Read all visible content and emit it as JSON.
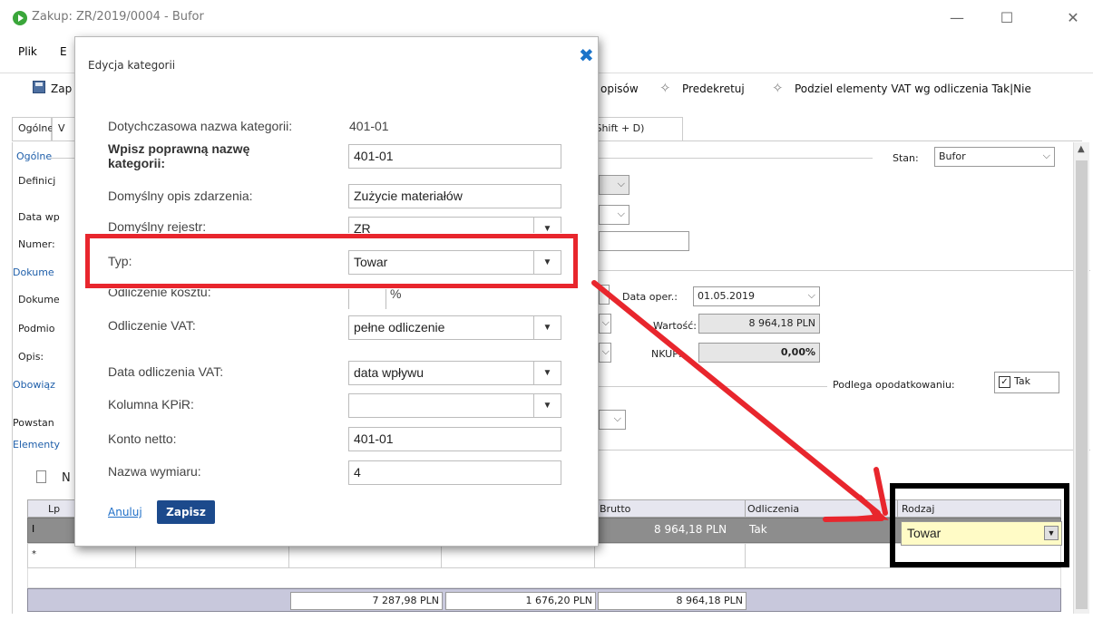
{
  "window": {
    "title": "Zakup: ZR/2019/0004 - Bufor",
    "minimize": "—",
    "maximize": "☐",
    "close": "✕"
  },
  "menu": {
    "file": "Plik",
    "edit": "E"
  },
  "toolbar": {
    "save_partial": "Zap",
    "opisow": "opisów",
    "predekretuj": "Predekretuj",
    "podziel": "Podziel elementy VAT wg odliczenia Tak|Nie"
  },
  "tabs": {
    "general": "Ogólne",
    "second": "V",
    "shortcut_tab": "- Shift + D)"
  },
  "form": {
    "ogolne_group": "Ogólne",
    "definicja": "Definicj",
    "data_wp": "Data wp",
    "numer": "Numer:",
    "dokume_group": "Dokume",
    "dokume": "Dokume",
    "podmiot": "Podmio",
    "opis": "Opis:",
    "obowiaz": "Obowiąz",
    "powstan": "Powstan",
    "elementy": "Elementy",
    "stan_label": "Stan:",
    "stan_value": "Bufor",
    "data_oper_label": "Data oper.:",
    "data_oper_value": "01.05.2019",
    "wartosc_label": "Wartość:",
    "wartosc_value": "8 964,18 PLN",
    "nkup_label": "NKUP:",
    "nkup_value": "0,00%",
    "podlega_label": "Podlega opodatkowaniu:",
    "podlega_value": "Tak",
    "new_partial": "N"
  },
  "grid": {
    "headers": {
      "lp": "Lp",
      "brutto": "Brutto",
      "odliczenia": "Odliczenia",
      "rodzaj": "Rodzaj"
    },
    "row1": {
      "marker": "I",
      "brutto": "8 964,18 PLN",
      "odliczenia": "Tak",
      "rodzaj": "Towar"
    },
    "row2": {
      "marker": "*"
    },
    "sums": [
      "7 287,98 PLN",
      "1 676,20 PLN",
      "8 964,18 PLN"
    ]
  },
  "dialog": {
    "title": "Edycja kategorii",
    "fields": {
      "dotychczasowa_label": "Dotychczasowa nazwa kategorii:",
      "dotychczasowa_value": "401-01",
      "wpisz_label": "Wpisz poprawną nazwę kategorii:",
      "wpisz_value": "401-01",
      "opis_label": "Domyślny opis zdarzenia:",
      "opis_value": "Zużycie materiałów",
      "rejestr_label": "Domyślny rejestr:",
      "rejestr_value": "ZR",
      "typ_label": "Typ:",
      "typ_value": "Towar",
      "odl_kosztu_label": "Odliczenie kosztu:",
      "odl_kosztu_unit": "%",
      "odl_vat_label": "Odliczenie VAT:",
      "odl_vat_value": "pełne odliczenie",
      "data_odl_label": "Data odliczenia VAT:",
      "data_odl_value": "data wpływu",
      "kpir_label": "Kolumna KPiR:",
      "kpir_value": "",
      "konto_label": "Konto netto:",
      "konto_value": "401-01",
      "wymiar_label": "Nazwa wymiaru:",
      "wymiar_value": "4"
    },
    "cancel": "Anuluj",
    "save": "Zapisz"
  },
  "colors": {
    "highlight_red": "#e8262d",
    "accent_blue": "#1c4a8c"
  }
}
